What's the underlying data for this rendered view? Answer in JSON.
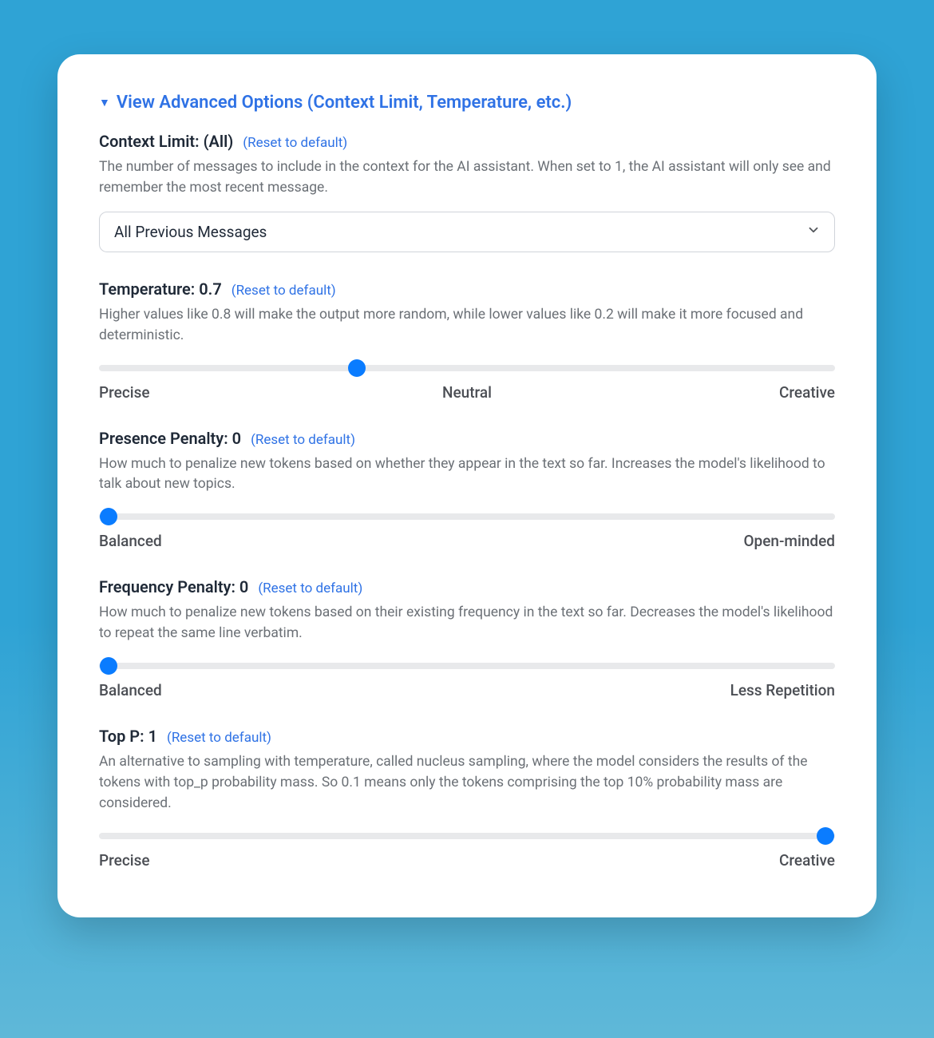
{
  "disclosure": {
    "label": "View Advanced Options (Context Limit, Temperature, etc.)"
  },
  "reset_label": "(Reset to default)",
  "context_limit": {
    "title_prefix": "Context Limit: ",
    "value_display": "(All)",
    "description": "The number of messages to include in the context for the AI assistant. When set to 1, the AI assistant will only see and remember the most recent message.",
    "selected": "All Previous Messages"
  },
  "temperature": {
    "title_prefix": "Temperature: ",
    "value_display": "0.7",
    "description": "Higher values like 0.8 will make the output more random, while lower values like 0.2 will make it more focused and deterministic.",
    "left_label": "Precise",
    "mid_label": "Neutral",
    "right_label": "Creative",
    "percent": 35
  },
  "presence_penalty": {
    "title_prefix": "Presence Penalty: ",
    "value_display": "0",
    "description": "How much to penalize new tokens based on whether they appear in the text so far. Increases the model's likelihood to talk about new topics.",
    "left_label": "Balanced",
    "right_label": "Open-minded",
    "percent": 1.3
  },
  "frequency_penalty": {
    "title_prefix": "Frequency Penalty: ",
    "value_display": "0",
    "description": "How much to penalize new tokens based on their existing frequency in the text so far. Decreases the model's likelihood to repeat the same line verbatim.",
    "left_label": "Balanced",
    "right_label": "Less Repetition",
    "percent": 1.3
  },
  "top_p": {
    "title_prefix": "Top P: ",
    "value_display": "1",
    "description": "An alternative to sampling with temperature, called nucleus sampling, where the model considers the results of the tokens with top_p probability mass. So 0.1 means only the tokens comprising the top 10% probability mass are considered.",
    "left_label": "Precise",
    "right_label": "Creative",
    "percent": 98.7
  }
}
